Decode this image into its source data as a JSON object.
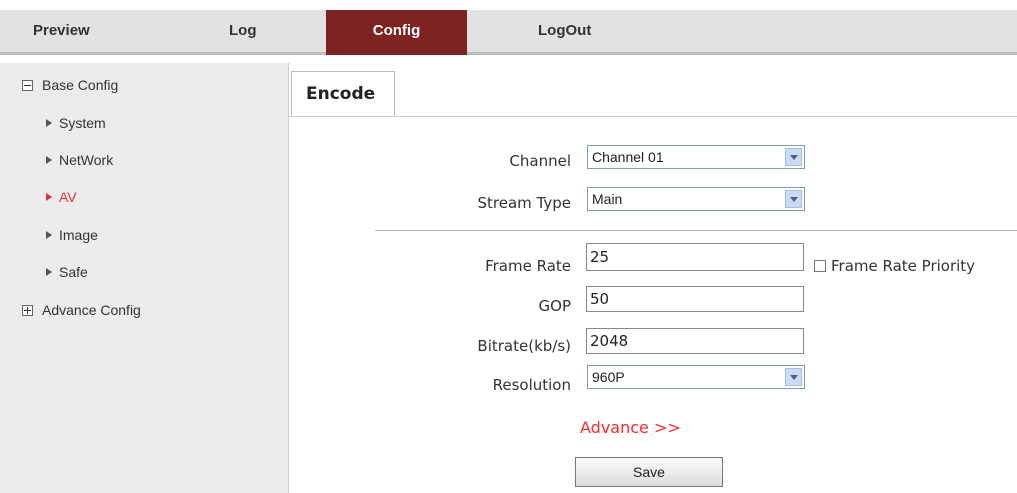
{
  "nav": {
    "preview": "Preview",
    "log": "Log",
    "config": "Config",
    "logout": "LogOut",
    "active": "Config"
  },
  "sidebar": {
    "base_config": "Base Config",
    "items": [
      "System",
      "NetWork",
      "AV",
      "Image",
      "Safe"
    ],
    "active_item": "AV",
    "advance_config": "Advance Config"
  },
  "tab": {
    "label": "Encode"
  },
  "form": {
    "channel_label": "Channel",
    "channel_value": "Channel 01",
    "stream_type_label": "Stream Type",
    "stream_type_value": "Main",
    "frame_rate_label": "Frame Rate",
    "frame_rate_value": "25",
    "frame_rate_priority_label": "Frame Rate Priority",
    "frame_rate_priority_checked": false,
    "gop_label": "GOP",
    "gop_value": "50",
    "bitrate_label": "Bitrate(kb/s)",
    "bitrate_value": "2048",
    "resolution_label": "Resolution",
    "resolution_value": "960P",
    "advance_link": "Advance >>",
    "save_button": "Save"
  },
  "colors": {
    "active_nav_bg": "#7e2222",
    "active_sidebar_text": "#e33333",
    "advance_link": "#ff2a2a"
  }
}
